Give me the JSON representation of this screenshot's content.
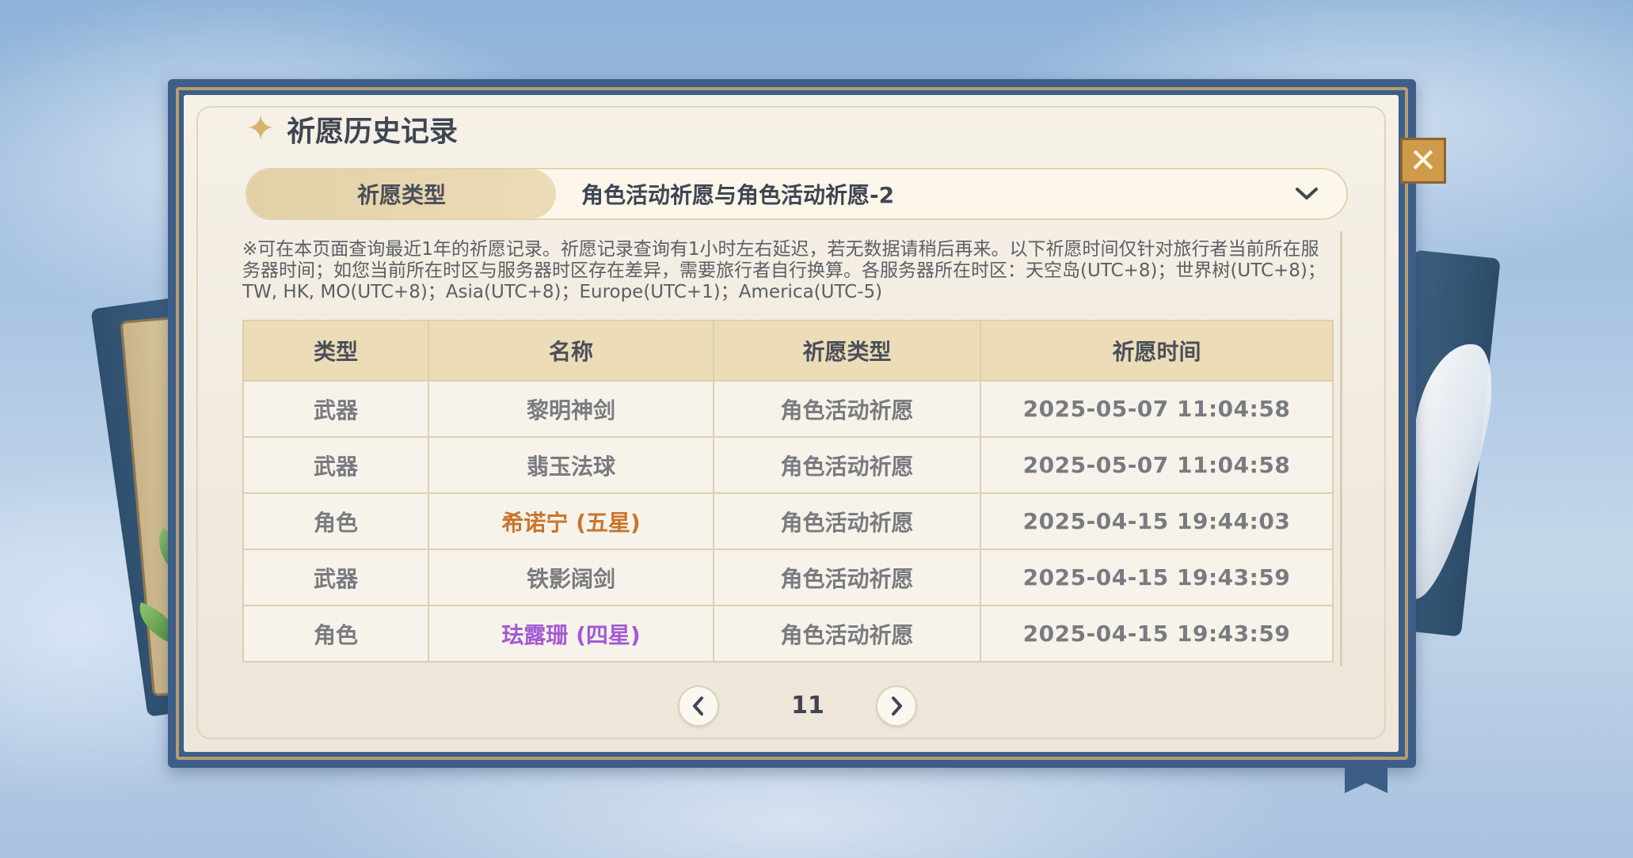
{
  "window": {
    "title": "祈愿历史记录",
    "close_label": "✕"
  },
  "filter": {
    "label": "祈愿类型",
    "selected": "角色活动祈愿与角色活动祈愿-2"
  },
  "notice": "※可在本页面查询最近1年的祈愿记录。祈愿记录查询有1小时左右延迟，若无数据请稍后再来。以下祈愿时间仅针对旅行者当前所在服务器时间；如您当前所在时区与服务器时区存在差异，需要旅行者自行换算。各服务器所在时区：天空岛(UTC+8)；世界树(UTC+8)；TW, HK, MO(UTC+8)；Asia(UTC+8)；Europe(UTC+1)；America(UTC-5)",
  "table": {
    "headers": [
      "类型",
      "名称",
      "祈愿类型",
      "祈愿时间"
    ],
    "rows": [
      {
        "type": "武器",
        "name": "黎明神剑",
        "wish": "角色活动祈愿",
        "time": "2025-05-07 11:04:58",
        "rarity": "3"
      },
      {
        "type": "武器",
        "name": "翡玉法球",
        "wish": "角色活动祈愿",
        "time": "2025-05-07 11:04:58",
        "rarity": "3"
      },
      {
        "type": "角色",
        "name": "希诺宁 (五星)",
        "wish": "角色活动祈愿",
        "time": "2025-04-15 19:44:03",
        "rarity": "5"
      },
      {
        "type": "武器",
        "name": "铁影阔剑",
        "wish": "角色活动祈愿",
        "time": "2025-04-15 19:43:59",
        "rarity": "3"
      },
      {
        "type": "角色",
        "name": "珐露珊 (四星)",
        "wish": "角色活动祈愿",
        "time": "2025-04-15 19:43:59",
        "rarity": "4"
      }
    ]
  },
  "pager": {
    "page": "11",
    "prev_icon": "chevron-left-icon",
    "next_icon": "chevron-right-icon"
  },
  "colors": {
    "five_star": "#c9752d",
    "four_star": "#a35ad3",
    "accent_gold": "#d7b46a",
    "frame_blue": "#3c5e89"
  }
}
